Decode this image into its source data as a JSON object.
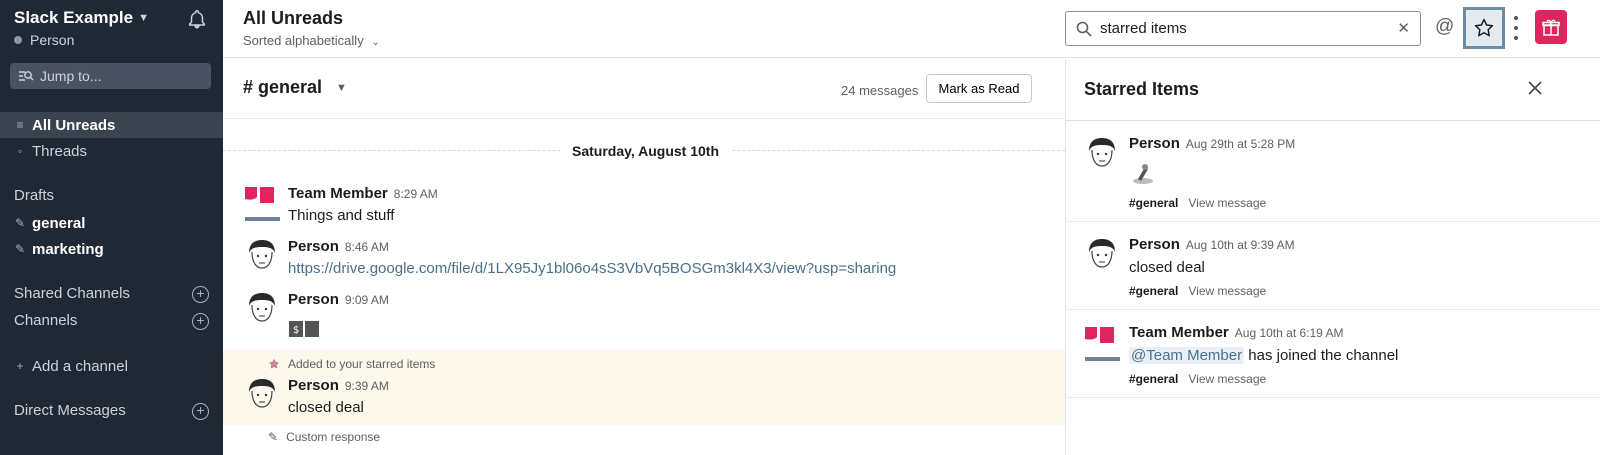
{
  "workspace": {
    "name": "Slack Example",
    "user": "Person"
  },
  "sidebar": {
    "jump_label": "Jump to...",
    "all_unreads": "All Unreads",
    "threads": "Threads",
    "drafts_heading": "Drafts",
    "drafts": [
      "general",
      "marketing"
    ],
    "shared_channels": "Shared Channels",
    "channels": "Channels",
    "add_channel": "Add a channel",
    "direct_messages": "Direct Messages"
  },
  "header": {
    "title": "All Unreads",
    "subtitle": "Sorted alphabetically",
    "search_value": "starred items"
  },
  "channel": {
    "name": "# general",
    "message_count": "24 messages",
    "mark_read": "Mark as Read",
    "date_divider": "Saturday, August 10th",
    "messages": [
      {
        "author": "Team Member",
        "time": "8:29 AM",
        "text": "Things and stuff"
      },
      {
        "author": "Person",
        "time": "8:46 AM",
        "text": "https://drive.google.com/file/d/1LX95Jy1bl06o4sS3VbVq5BOSGm3kl4X3/view?usp=sharing"
      },
      {
        "author": "Person",
        "time": "9:09 AM",
        "text": ""
      },
      {
        "author": "Person",
        "time": "9:39 AM",
        "text": "closed deal"
      }
    ],
    "added_note": "Added to your starred items",
    "custom_note": "Custom response"
  },
  "starred": {
    "title": "Starred Items",
    "items": [
      {
        "author": "Person",
        "time": "Aug 29th at 5:28 PM",
        "text": "",
        "channel": "#general",
        "action": "View message"
      },
      {
        "author": "Person",
        "time": "Aug 10th at 9:39 AM",
        "text": "closed deal",
        "channel": "#general",
        "action": "View message"
      },
      {
        "author": "Team Member",
        "time": "Aug 10th at 6:19 AM",
        "mention": "@Team Member",
        "text": "has joined the channel",
        "channel": "#general",
        "action": "View message"
      }
    ]
  },
  "colors": {
    "sidebar_bg": "#1f2835",
    "accent": "#e0245e",
    "starred_bg": "#fdf8ec",
    "link": "#4a6f8a"
  }
}
